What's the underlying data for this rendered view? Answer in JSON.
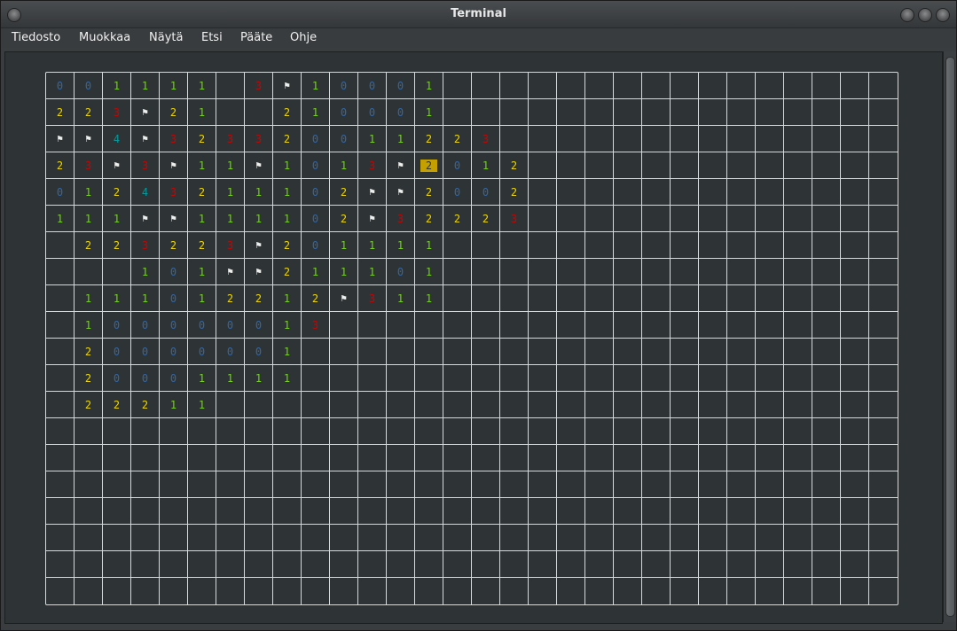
{
  "window": {
    "title": "Terminal"
  },
  "menu": [
    {
      "label": "Tiedosto"
    },
    {
      "label": "Muokkaa"
    },
    {
      "label": "Näytä"
    },
    {
      "label": "Etsi"
    },
    {
      "label": "Pääte"
    },
    {
      "label": "Ohje"
    }
  ],
  "board": {
    "cols": 30,
    "rows": 20,
    "flag_glyph": "⚑",
    "cursor": {
      "row": 3,
      "col": 13
    },
    "colors": {
      "0": "#3465a4",
      "1": "#73d216",
      "2": "#edd400",
      "3": "#cc0000",
      "4": "#06989a",
      "F": "#eeeeec"
    },
    "cells": [
      [
        "0",
        "0",
        "1",
        "1",
        "1",
        "1",
        " ",
        "3",
        "F",
        "1",
        "0",
        "0",
        "0",
        "1"
      ],
      [
        "2",
        "2",
        "3",
        "F",
        "2",
        "1",
        " ",
        " ",
        "2",
        "1",
        "0",
        "0",
        "0",
        "1"
      ],
      [
        "F",
        "F",
        "4",
        "F",
        "3",
        "2",
        "3",
        "3",
        "2",
        "0",
        "0",
        "1",
        "1",
        "2",
        "2",
        "3"
      ],
      [
        "2",
        "3",
        "F",
        "3",
        "F",
        "1",
        "1",
        "F",
        "1",
        "0",
        "1",
        "3",
        "F",
        "2",
        "0",
        "1",
        "2"
      ],
      [
        "0",
        "1",
        "2",
        "4",
        "3",
        "2",
        "1",
        "1",
        "1",
        "0",
        "2",
        "F",
        "F",
        "2",
        "0",
        "0",
        "2"
      ],
      [
        "1",
        "1",
        "1",
        "F",
        "F",
        "1",
        "1",
        "1",
        "1",
        "0",
        "2",
        "F",
        "3",
        "2",
        "2",
        "2",
        "3"
      ],
      [
        " ",
        "2",
        "2",
        "3",
        "2",
        "2",
        "3",
        "F",
        "2",
        "0",
        "1",
        "1",
        "1",
        "1"
      ],
      [
        " ",
        " ",
        " ",
        "1",
        "0",
        "1",
        "F",
        "F",
        "2",
        "1",
        "1",
        "1",
        "0",
        "1"
      ],
      [
        " ",
        "1",
        "1",
        "1",
        "0",
        "1",
        "2",
        "2",
        "1",
        "2",
        "F",
        "3",
        "1",
        "1"
      ],
      [
        " ",
        "1",
        "0",
        "0",
        "0",
        "0",
        "0",
        "0",
        "1",
        "3"
      ],
      [
        " ",
        "2",
        "0",
        "0",
        "0",
        "0",
        "0",
        "0",
        "1"
      ],
      [
        " ",
        "2",
        "0",
        "0",
        "0",
        "1",
        "1",
        "1",
        "1"
      ],
      [
        " ",
        "2",
        "2",
        "2",
        "1",
        "1"
      ],
      [],
      [],
      [],
      [],
      [],
      [],
      []
    ]
  }
}
